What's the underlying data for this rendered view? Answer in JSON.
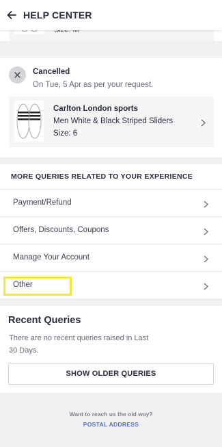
{
  "header": {
    "title": "HELP CENTER",
    "back_icon": "arrow-left-icon"
  },
  "previous_item": {
    "size": "Size: M"
  },
  "order": {
    "status": "Cancelled",
    "status_detail": "On Tue, 5 Apr as per your request.",
    "status_icon": "close-icon",
    "product": {
      "brand": "Carlton London sports",
      "name": "Men White & Black Striped Sliders",
      "size": "Size: 6"
    }
  },
  "queries": {
    "heading": "MORE QUERIES RELATED TO YOUR EXPERIENCE",
    "items": [
      {
        "label": "Payment/Refund"
      },
      {
        "label": "Offers, Discounts, Coupons"
      },
      {
        "label": "Manage Your Account"
      },
      {
        "label": "Other"
      }
    ],
    "highlight_color": "#f2ea34"
  },
  "recent": {
    "title": "Recent Queries",
    "empty_text": "There are no recent queries raised in Last 30 Days.",
    "button_label": "SHOW OLDER QUERIES"
  },
  "footer": {
    "prompt": "Want to reach us the old way?",
    "link_label": "POSTAL ADDRESS",
    "link_color": "#526cd0"
  }
}
